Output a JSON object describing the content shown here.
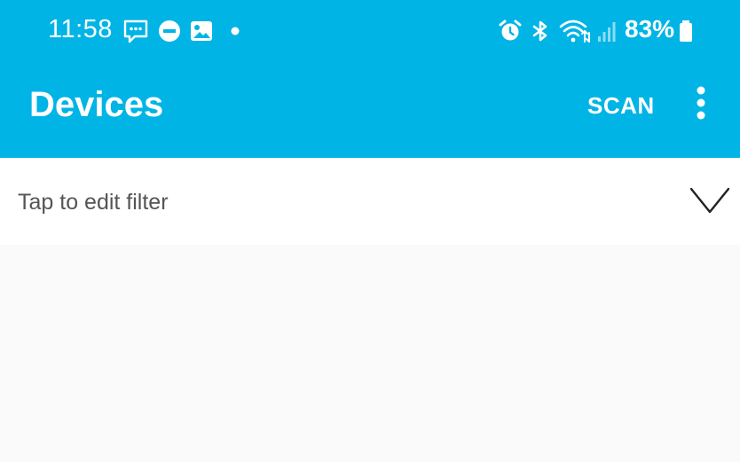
{
  "status_bar": {
    "time": "11:58",
    "battery_percent": "83%",
    "left_icons": [
      "message-icon",
      "do-not-disturb-icon",
      "gallery-icon",
      "notification-dot-icon"
    ],
    "right_icons": [
      "alarm-icon",
      "bluetooth-icon",
      "wifi-icon",
      "signal-icon",
      "battery-icon"
    ]
  },
  "toolbar": {
    "title": "Devices",
    "scan_label": "SCAN",
    "overflow_icon": "more-vert-icon"
  },
  "filter": {
    "label": "Tap to edit filter",
    "expand_icon": "chevron-down-icon"
  },
  "colors": {
    "app_bar": "#00b4e6",
    "background": "#fafafa",
    "filter_bg": "#ffffff",
    "filter_text": "#555555"
  }
}
